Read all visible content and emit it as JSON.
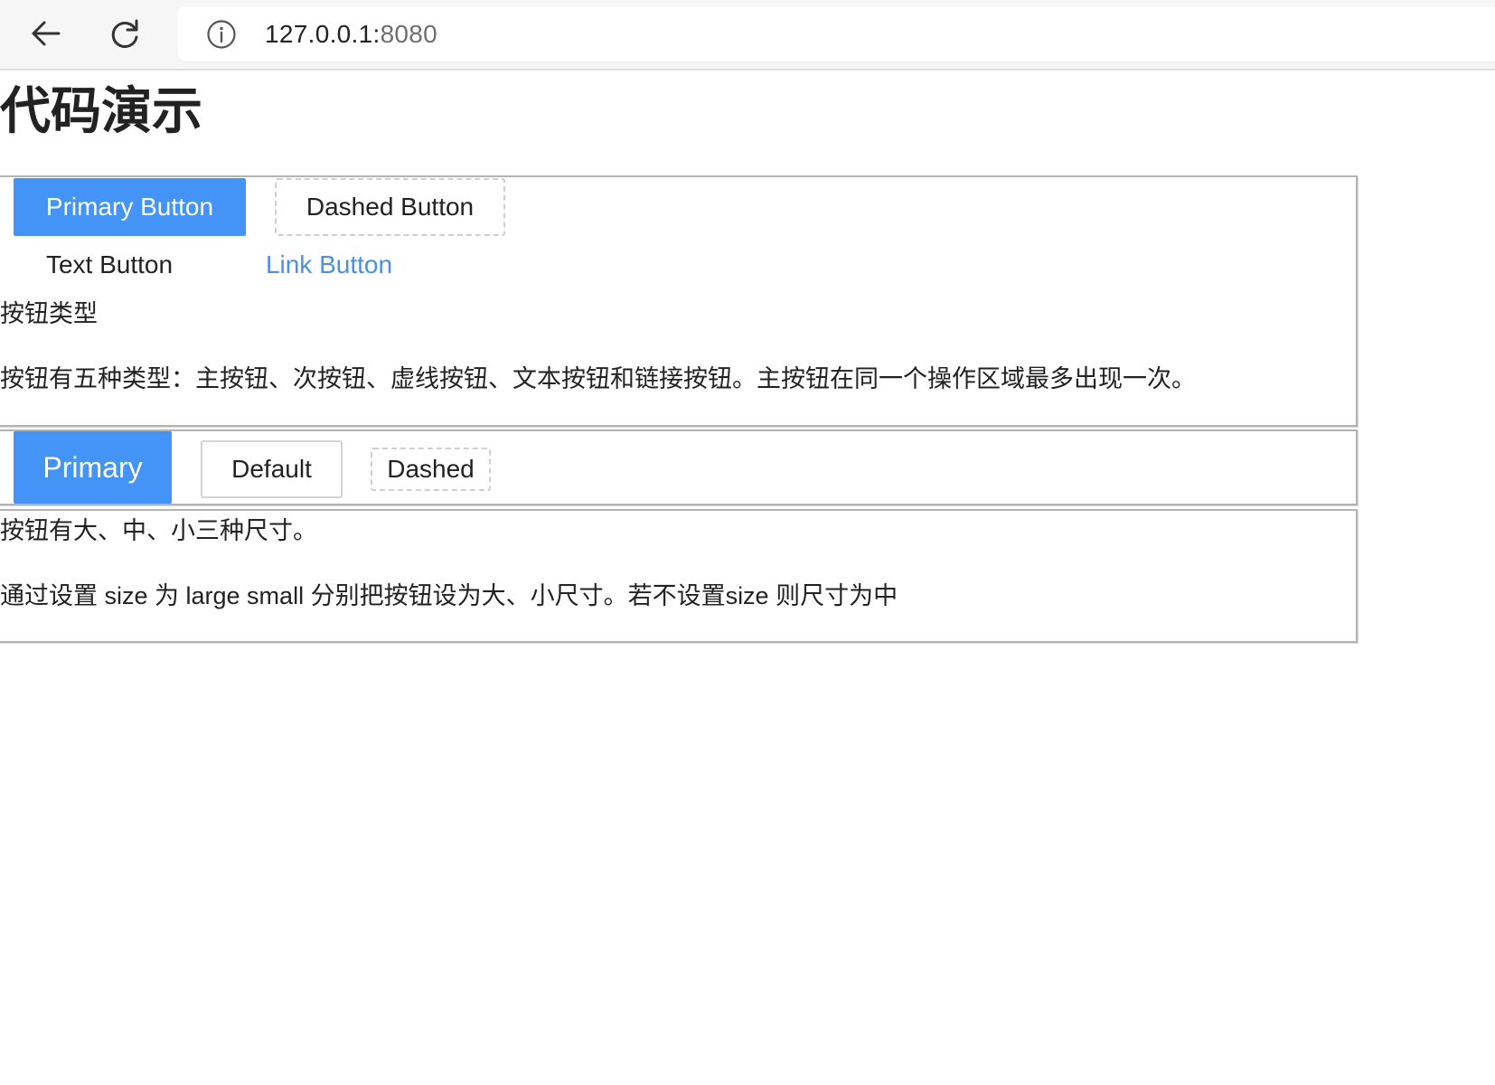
{
  "browser": {
    "url_host": "127.0.0.1:",
    "url_port": "8080"
  },
  "page": {
    "title": "代码演示"
  },
  "button_types_demo": {
    "primary_label": "Primary Button",
    "dashed_label": "Dashed Button",
    "text_label": "Text Button",
    "link_label": "Link Button",
    "section_title": "按钮类型",
    "description": "按钮有五种类型：主按钮、次按钮、虚线按钮、文本按钮和链接按钮。主按钮在同一个操作区域最多出现一次。"
  },
  "button_sizes_demo": {
    "primary_label": "Primary",
    "default_label": "Default",
    "dashed_label": "Dashed",
    "section_title": "按钮有大、中、小三种尺寸。",
    "description": "通过设置 size 为 large small 分别把按钮设为大、小尺寸。若不设置size 则尺寸为中"
  },
  "colors": {
    "primary": "#4494f7",
    "link": "#4a90e2",
    "border": "#b3b3b3"
  }
}
